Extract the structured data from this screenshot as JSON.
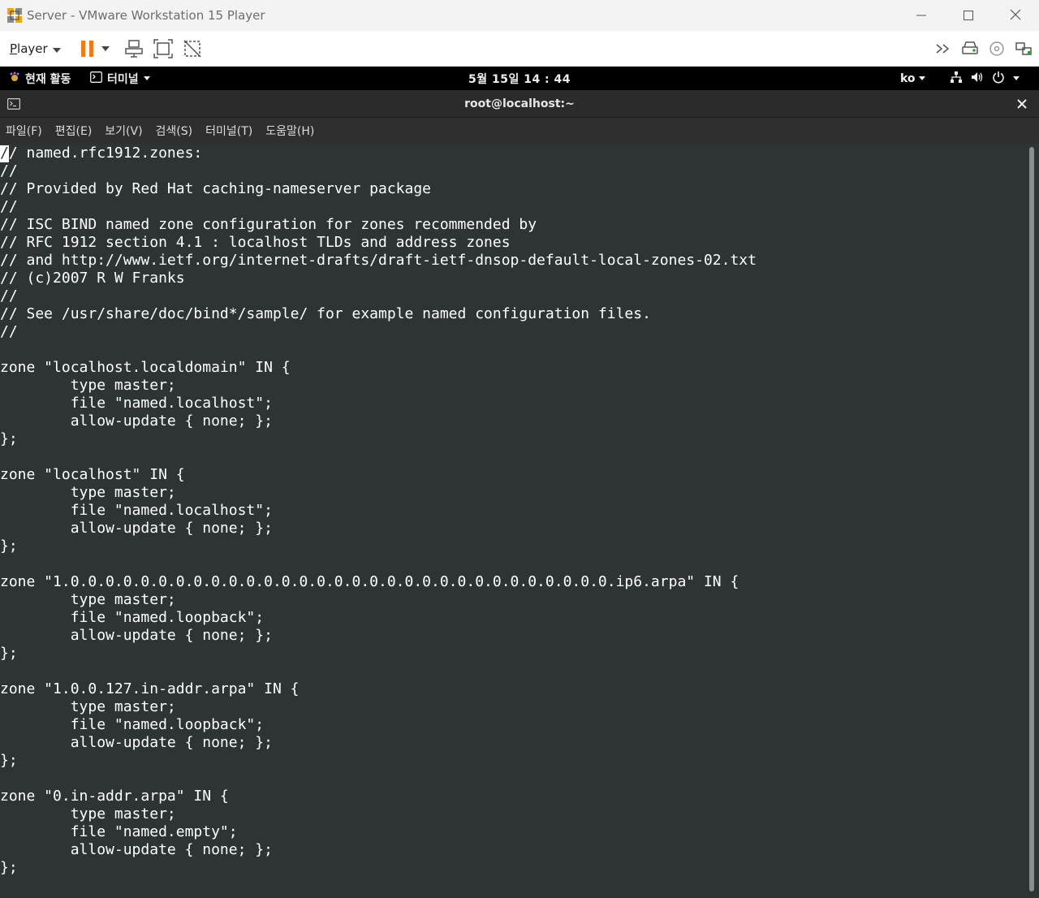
{
  "window": {
    "title": "Server - VMware Workstation 15 Player",
    "app_icon": "vmware-icon",
    "controls": [
      "minimize-icon",
      "maximize-icon",
      "close-icon"
    ]
  },
  "toolbar": {
    "player_label": "Player",
    "player_underline": "P",
    "player_rest": "layer",
    "left_icons": [
      "pause-icon",
      "dropdown-icon",
      "send-ctrl-alt-del-icon",
      "fullscreen-icon",
      "unity-icon"
    ],
    "right_icons": [
      "more-icon",
      "hard-disk-icon",
      "cd-icon",
      "network-adapter-icon"
    ]
  },
  "gnome": {
    "activities": "현재 활동",
    "app_menu": "터미널",
    "clock": "5월 15일 14 : 44",
    "lang": "ko",
    "status_icons": [
      "network-icon",
      "volume-icon",
      "power-icon"
    ]
  },
  "terminal": {
    "title": "root@localhost:~",
    "menu": [
      "파일(F)",
      "편집(E)",
      "보기(V)",
      "검색(S)",
      "터미널(T)",
      "도움말(H)"
    ],
    "cursor_char": "/",
    "text": "// named.rfc1912.zones:\n//\n// Provided by Red Hat caching-nameserver package\n//\n// ISC BIND named zone configuration for zones recommended by\n// RFC 1912 section 4.1 : localhost TLDs and address zones\n// and http://www.ietf.org/internet-drafts/draft-ietf-dnsop-default-local-zones-02.txt\n// (c)2007 R W Franks\n//\n// See /usr/share/doc/bind*/sample/ for example named configuration files.\n//\n\nzone \"localhost.localdomain\" IN {\n        type master;\n        file \"named.localhost\";\n        allow-update { none; };\n};\n\nzone \"localhost\" IN {\n        type master;\n        file \"named.localhost\";\n        allow-update { none; };\n};\n\nzone \"1.0.0.0.0.0.0.0.0.0.0.0.0.0.0.0.0.0.0.0.0.0.0.0.0.0.0.0.0.0.0.0.ip6.arpa\" IN {\n        type master;\n        file \"named.loopback\";\n        allow-update { none; };\n};\n\nzone \"1.0.0.127.in-addr.arpa\" IN {\n        type master;\n        file \"named.loopback\";\n        allow-update { none; };\n};\n\nzone \"0.in-addr.arpa\" IN {\n        type master;\n        file \"named.empty\";\n        allow-update { none; };\n};"
  }
}
